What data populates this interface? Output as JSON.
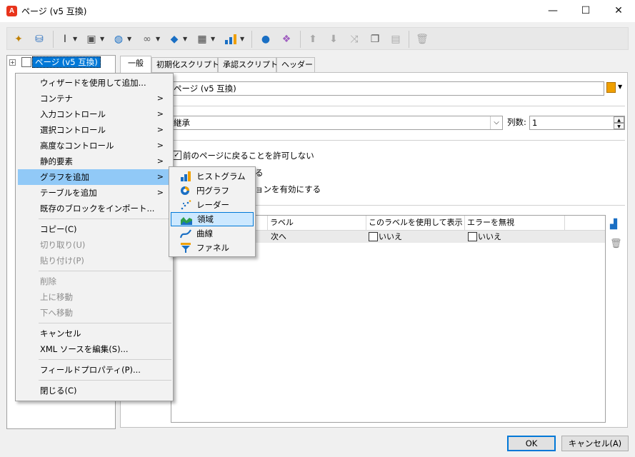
{
  "window": {
    "logo": "A",
    "title": "ページ (v5 互換)",
    "minimize": "—",
    "maximize": "☐",
    "close": "✕"
  },
  "toolbar": {
    "icons": [
      "wand-icon",
      "database-upload-icon",
      "text-cursor-icon",
      "form-add-icon",
      "globe-icon",
      "link-icon",
      "stack-icon",
      "table-icon",
      "bar-chart-icon",
      "user-icon",
      "component-add-icon",
      "arrow-up-icon",
      "arrow-down-icon",
      "shuffle-icon",
      "copy-icon",
      "paste-icon",
      "delete-icon"
    ]
  },
  "tree": {
    "expander": "+",
    "node_label": "ページ (v5 互換)"
  },
  "tabs": [
    "一般",
    "初期化スクリプト",
    "承認スクリプト",
    "ヘッダー"
  ],
  "form": {
    "label_field_value": "ページ (v5 互換)",
    "style_select_value": "継承",
    "columns_label": "列数:",
    "columns_value": "1",
    "checkbox1_label": "前のページに戻ることを許可しない",
    "checkbox2_partial": "る",
    "checkbox3_partial": "ョンを有効にする"
  },
  "grid": {
    "columns": [
      "ラベル",
      "このラベルを使用して表示",
      "エラーを無視"
    ],
    "rows": [
      {
        "label": "次へ",
        "use_label": "いいえ",
        "ignore_error": "いいえ"
      }
    ]
  },
  "context_menu": {
    "items": [
      {
        "label": "ウィザードを使用して追加..."
      },
      {
        "label": "コンテナ",
        "arrow": ">"
      },
      {
        "label": "入力コントロール",
        "arrow": ">"
      },
      {
        "label": "選択コントロール",
        "arrow": ">"
      },
      {
        "label": "高度なコントロール",
        "arrow": ">"
      },
      {
        "label": "静的要素",
        "arrow": ">"
      },
      {
        "label": "グラフを追加",
        "arrow": ">"
      },
      {
        "label": "テーブルを追加",
        "arrow": ">"
      },
      {
        "label": "既存のブロックをインポート..."
      },
      {
        "label": "コピー(C)"
      },
      {
        "label": "切り取り(U)"
      },
      {
        "label": "貼り付け(P)"
      },
      {
        "label": "削除"
      },
      {
        "label": "上に移動"
      },
      {
        "label": "下へ移動"
      },
      {
        "label": "キャンセル"
      },
      {
        "label": "XML ソースを編集(S)..."
      },
      {
        "label": "フィールドプロパティ(P)..."
      },
      {
        "label": "閉じる(C)"
      }
    ]
  },
  "chart_submenu": {
    "items": [
      {
        "label": "ヒストグラム",
        "icon": "histogram-icon",
        "color": "#f0a000"
      },
      {
        "label": "円グラフ",
        "icon": "pie-chart-icon",
        "color": "#1a6fc4"
      },
      {
        "label": "レーダー",
        "icon": "radar-icon",
        "color": "#1a6fc4"
      },
      {
        "label": "領域",
        "icon": "area-chart-icon",
        "color": "#2e9e4a"
      },
      {
        "label": "曲線",
        "icon": "curve-icon",
        "color": "#1a6fc4"
      },
      {
        "label": "ファネル",
        "icon": "funnel-icon",
        "color": "#1a6fc4"
      }
    ]
  },
  "buttons": {
    "ok": "OK",
    "cancel": "キャンセル(A)"
  },
  "colors": {
    "accent": "#0078d7",
    "menu_highlight": "#91c9f7",
    "logo": "#e8341c"
  }
}
